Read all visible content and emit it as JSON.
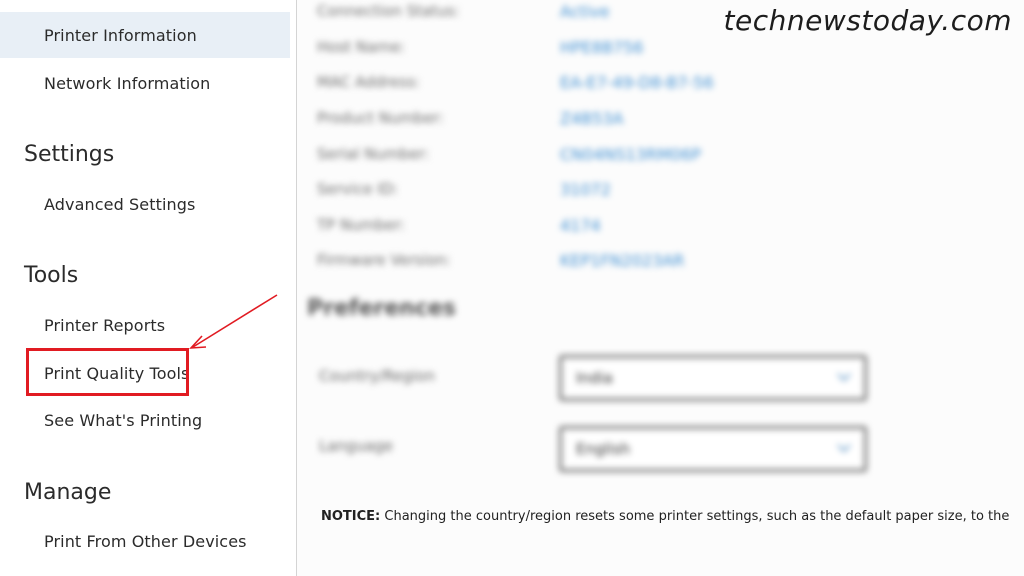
{
  "sidebar": {
    "items_top": [
      {
        "label": "Printer Information",
        "selected": true
      },
      {
        "label": "Network Information",
        "selected": false
      }
    ],
    "sections": [
      {
        "heading": "Settings",
        "items": [
          {
            "label": "Advanced Settings"
          }
        ]
      },
      {
        "heading": "Tools",
        "items": [
          {
            "label": "Printer Reports"
          },
          {
            "label": "Print Quality Tools",
            "highlighted": true
          },
          {
            "label": "See What's Printing"
          }
        ]
      },
      {
        "heading": "Manage",
        "items": [
          {
            "label": "Print From Other Devices"
          }
        ]
      }
    ]
  },
  "main": {
    "printer_info": [
      {
        "label": "Connection Status:",
        "value": "Active"
      },
      {
        "label": "Host Name:",
        "value": "HPE8B756"
      },
      {
        "label": "MAC Address:",
        "value": "EA-E7-49-D8-B7-56"
      },
      {
        "label": "Product Number:",
        "value": "Z4B53A"
      },
      {
        "label": "Serial Number:",
        "value": "CN04NS13RM06P"
      },
      {
        "label": "Service ID:",
        "value": "31072"
      },
      {
        "label": "TP Number:",
        "value": "4174"
      },
      {
        "label": "Firmware Version:",
        "value": "KEP1FN2023AR"
      }
    ],
    "preferences": {
      "heading": "Preferences",
      "country_label": "Country/Region",
      "country_value": "India",
      "language_label": "Language",
      "language_value": "English"
    },
    "notice_label": "NOTICE:",
    "notice_text": " Changing the country/region resets some printer settings, such as the default paper size, to the"
  },
  "watermark": "technewstoday.com",
  "colors": {
    "selected_bg": "#e8eff6",
    "highlight": "#e11b22",
    "link_value": "#3f8fd2"
  }
}
